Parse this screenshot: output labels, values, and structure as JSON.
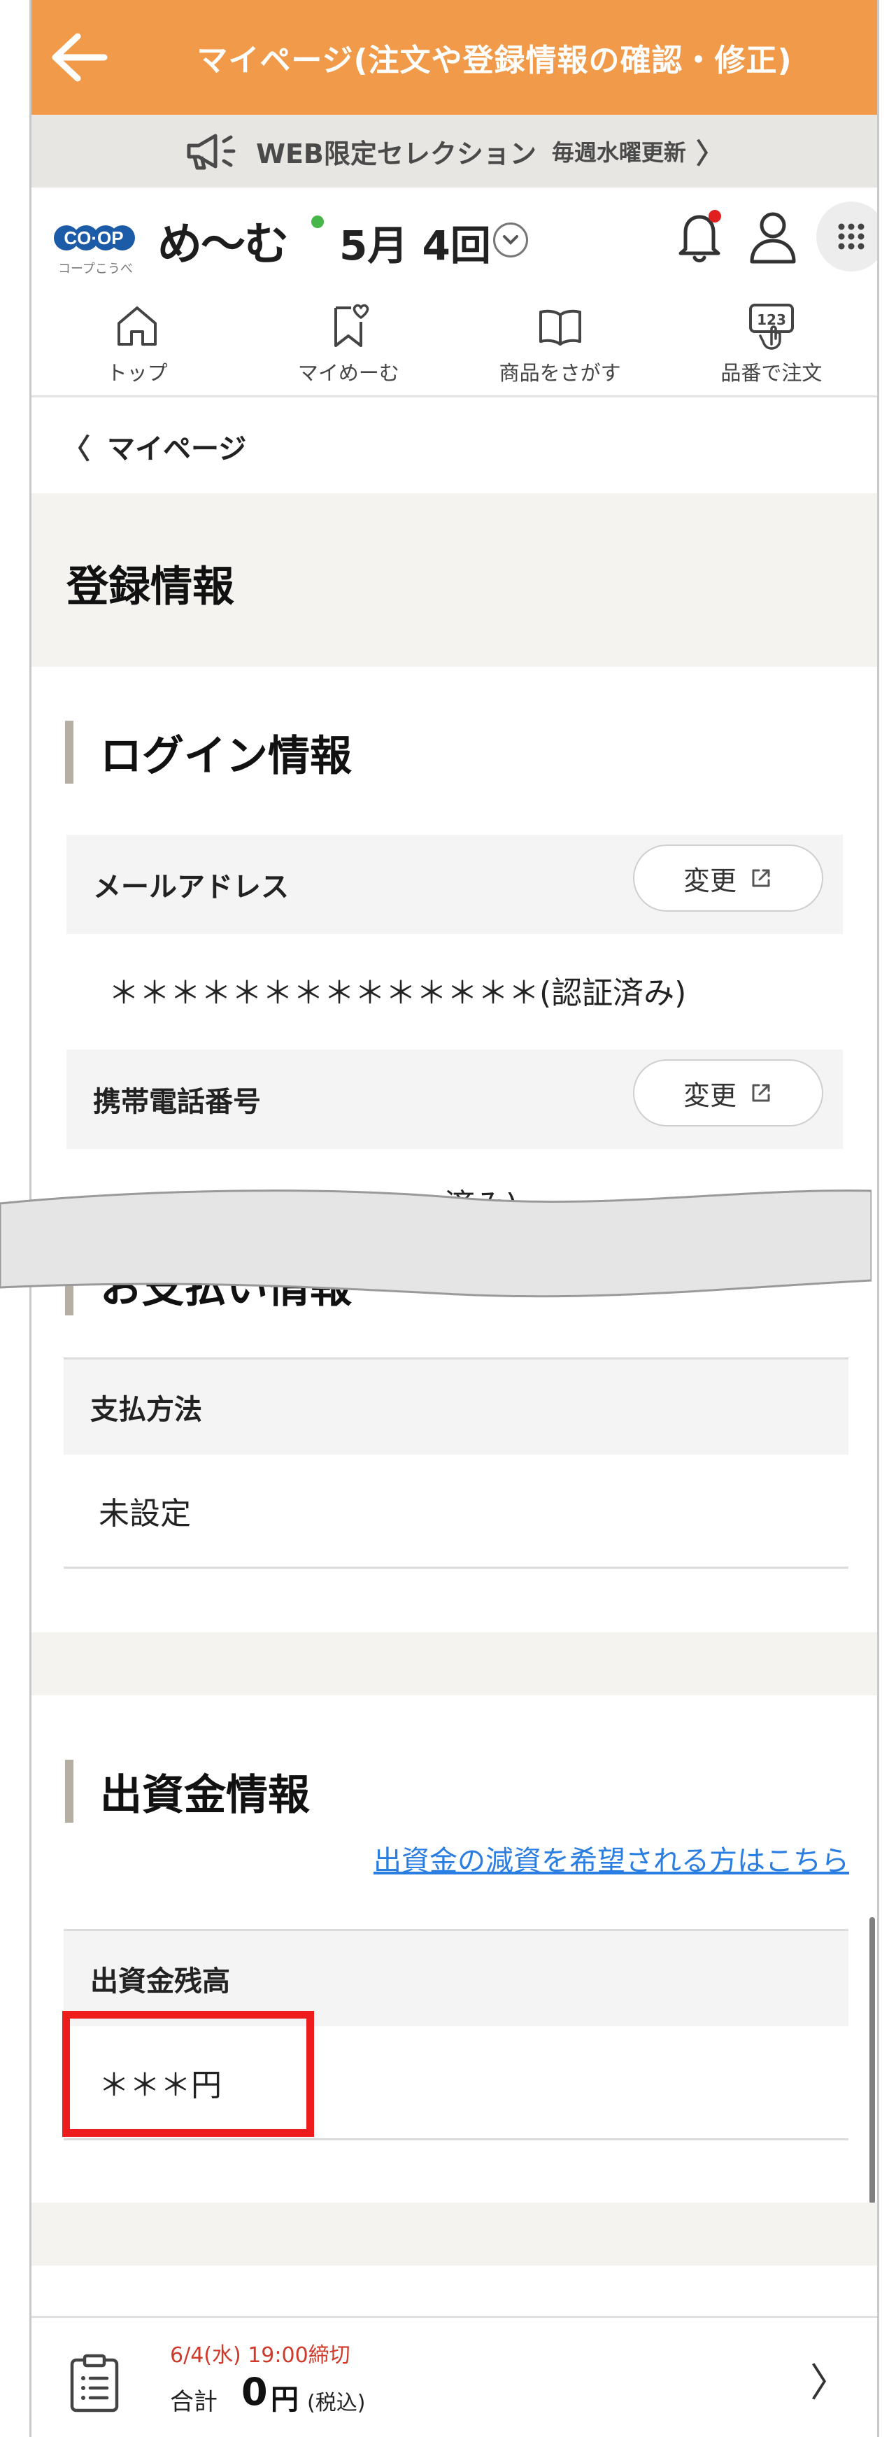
{
  "header": {
    "title": "マイページ(注文や登録情報の確認・修正)"
  },
  "announcement": {
    "text": "WEB限定セレクション",
    "sub": "毎週水曜更新",
    "chevron": "〉"
  },
  "brand": {
    "logo_text": "CO·OP",
    "logo_sub": "コープこうべ",
    "name": "め〜む",
    "round": "5月 4回"
  },
  "nav": {
    "items": [
      {
        "label": "トップ",
        "icon": "home-icon"
      },
      {
        "label": "マイめーむ",
        "icon": "bookmark-heart-icon"
      },
      {
        "label": "商品をさがす",
        "icon": "book-icon"
      },
      {
        "label": "品番で注文",
        "icon": "number-tap-icon"
      }
    ],
    "number_icon_text": "123"
  },
  "breadcrumb": {
    "chevron": "〈",
    "label": "マイページ"
  },
  "page": {
    "title": "登録情報"
  },
  "login": {
    "heading": "ログイン情報",
    "email_label": "メールアドレス",
    "email_value": "＊＊＊＊＊＊＊＊＊＊＊＊＊＊(認証済み)",
    "phone_label": "携帯電話番号",
    "phone_value_partial": "済み)",
    "change_label": "変更"
  },
  "payment": {
    "heading": "お支払い情報",
    "method_label": "支払方法",
    "method_value": "未設定"
  },
  "investment": {
    "heading": "出資金情報",
    "link": "出資金の減資を希望される方はこちら",
    "balance_label": "出資金残高",
    "balance_value": "＊＊＊円"
  },
  "footer": {
    "deadline": "6/4(水) 19:00締切",
    "total_label": "合計",
    "amount": "0",
    "unit": "円",
    "tax": "(税込)",
    "next": "〉"
  },
  "colors": {
    "accent": "#f09a4a",
    "highlight": "#ee1c1c",
    "link": "#2a7de1",
    "notification": "#e02020"
  }
}
